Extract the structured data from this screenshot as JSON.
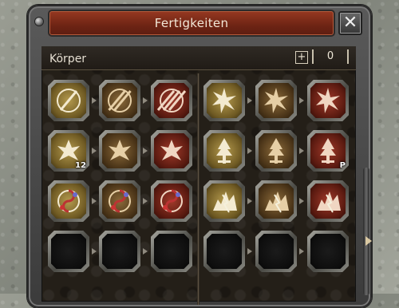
{
  "window": {
    "title": "Fertigkeiten",
    "close_label": "✕"
  },
  "category": {
    "label": "Körper",
    "plus_label": "+",
    "points": "0"
  },
  "skills": {
    "left": [
      [
        {
          "icon": "sword-slash-icon",
          "tone": "gold",
          "level": ""
        },
        {
          "icon": "sword-slash-double-icon",
          "tone": "brown",
          "level": ""
        },
        {
          "icon": "sword-slash-triple-icon",
          "tone": "red",
          "level": ""
        }
      ],
      [
        {
          "icon": "warrior-aura-icon",
          "tone": "gold",
          "level": "12"
        },
        {
          "icon": "warrior-aura-icon",
          "tone": "brown",
          "level": ""
        },
        {
          "icon": "warrior-aura-icon",
          "tone": "red",
          "level": ""
        }
      ],
      [
        {
          "icon": "yin-yang-icon",
          "tone": "gold",
          "level": ""
        },
        {
          "icon": "yin-yang-icon",
          "tone": "brown",
          "level": ""
        },
        {
          "icon": "yin-yang-icon",
          "tone": "red",
          "level": ""
        }
      ],
      [
        {
          "icon": "empty-slot",
          "tone": "empty",
          "level": ""
        },
        {
          "icon": "empty-slot",
          "tone": "empty",
          "level": ""
        },
        {
          "icon": "empty-slot",
          "tone": "empty",
          "level": ""
        }
      ]
    ],
    "right": [
      [
        {
          "icon": "star-burst-icon",
          "tone": "gold",
          "level": ""
        },
        {
          "icon": "star-burst-icon",
          "tone": "brown",
          "level": ""
        },
        {
          "icon": "star-burst-icon",
          "tone": "red",
          "level": ""
        }
      ],
      [
        {
          "icon": "tree-sword-icon",
          "tone": "gold",
          "level": ""
        },
        {
          "icon": "tree-sword-icon",
          "tone": "brown",
          "level": ""
        },
        {
          "icon": "tree-sword-icon",
          "tone": "red",
          "level": "P"
        }
      ],
      [
        {
          "icon": "lightning-ground-icon",
          "tone": "gold",
          "level": ""
        },
        {
          "icon": "lightning-ground-icon",
          "tone": "brown",
          "level": ""
        },
        {
          "icon": "lightning-ground-icon",
          "tone": "red",
          "level": ""
        }
      ],
      [
        {
          "icon": "empty-slot",
          "tone": "empty",
          "level": ""
        },
        {
          "icon": "empty-slot",
          "tone": "empty",
          "level": ""
        },
        {
          "icon": "empty-slot",
          "tone": "empty",
          "level": ""
        }
      ]
    ]
  }
}
